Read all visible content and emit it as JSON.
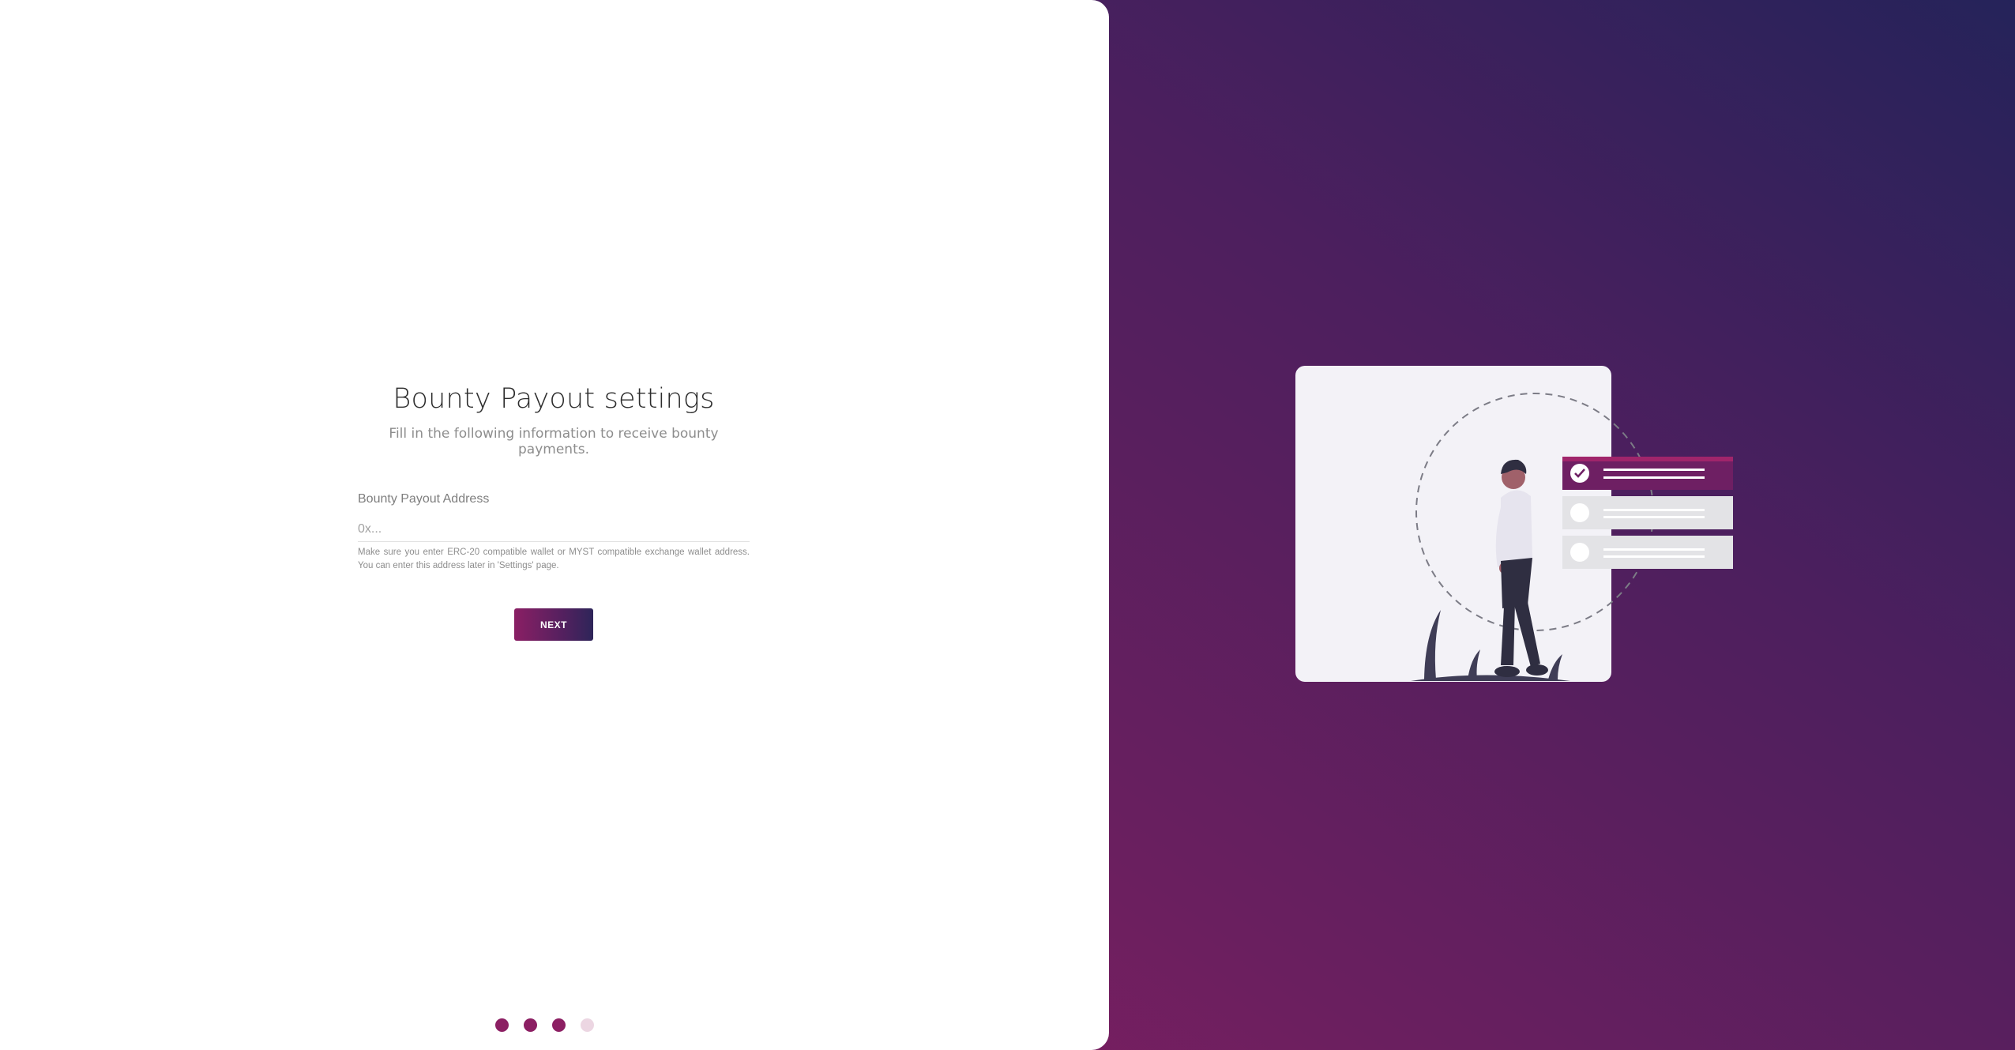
{
  "form": {
    "title": "Bounty Payout settings",
    "subtitle": "Fill in the following information to receive bounty payments.",
    "address_label": "Bounty Payout Address",
    "address_placeholder": "0x...",
    "address_value": "",
    "hint": "Make sure you enter ERC-20 compatible wallet or MYST compatible exchange wallet address. You can enter this address later in 'Settings' page.",
    "next_label": "NEXT"
  },
  "steps": {
    "total": 4,
    "completed": 3
  },
  "colors": {
    "accent": "#8c1f63",
    "gradient_start": "#9a1d62",
    "gradient_end": "#25235a",
    "inactive_dot": "#ecd6e2"
  },
  "illustration": {
    "name": "person-with-checklist-illustration"
  }
}
